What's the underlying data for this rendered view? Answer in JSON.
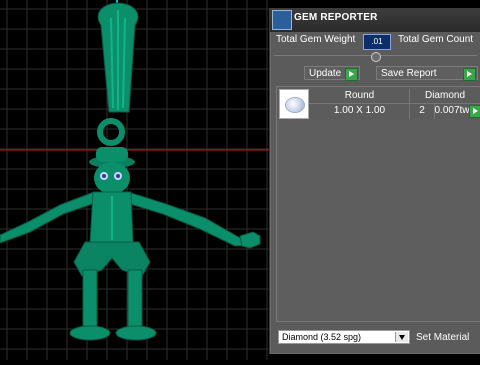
{
  "panel": {
    "title": "GEM REPORTER",
    "total_weight_label": "Total Gem Weight",
    "total_weight_value": ".01",
    "total_count_label": "Total Gem Count",
    "update_label": "Update",
    "save_report_label": "Save Report",
    "table": {
      "headers": {
        "shape": "Round",
        "stone": "Diamond"
      },
      "row": {
        "size": "1.00 X 1.00",
        "count": "2",
        "weight": "0.007tw"
      }
    },
    "material_dropdown": "Diamond      (3.52 spg)",
    "set_material_label": "Set Material"
  },
  "viewport": {
    "background": "#000000",
    "grid_color": "#2e2e2e",
    "model_color": "#0b8f6a",
    "axis_red": "#b31a1a",
    "axis_blue": "#19b5c9"
  }
}
